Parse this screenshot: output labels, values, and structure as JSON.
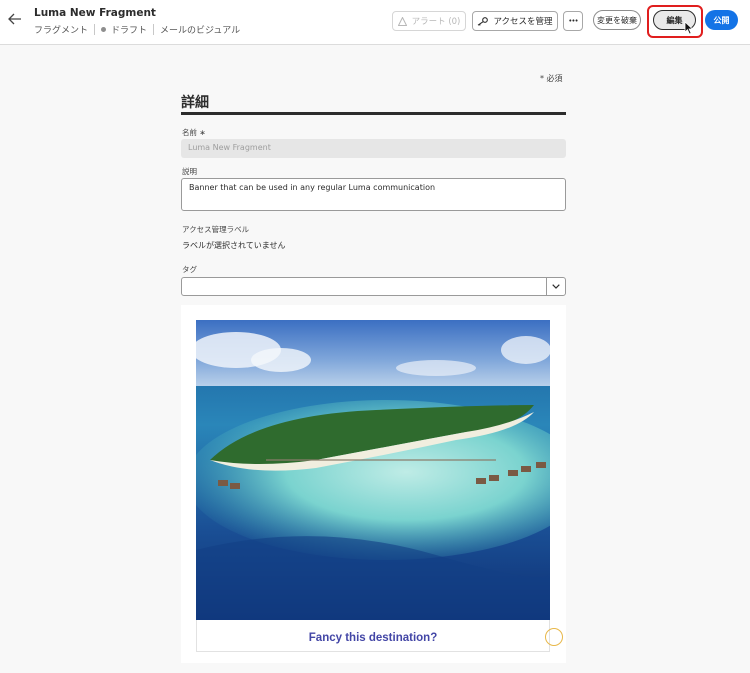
{
  "header": {
    "title": "Luma New Fragment",
    "breadcrumbs": [
      "フラグメント",
      "ドラフト",
      "メールのビジュアル"
    ],
    "alerts_label": "アラート (0)",
    "manage_access_label": "アクセスを管理",
    "more_label": "•••",
    "discard_label": "変更を破棄",
    "edit_label": "編集",
    "publish_label": "公開"
  },
  "form": {
    "required_note": "* 必須",
    "section_title": "詳細",
    "name_label": "名前 ∗",
    "name_value": "Luma New Fragment",
    "description_label": "説明",
    "description_value": "Banner that can be used in any regular Luma communication",
    "access_label": "アクセス管理ラベル",
    "access_value": "ラベルが選択されていません",
    "tags_label": "タグ",
    "tags_value": ""
  },
  "preview": {
    "caption": "Fancy this destination?"
  },
  "colors": {
    "accent": "#1473e6",
    "highlight": "#e01e1e",
    "caption": "#4346a6"
  }
}
